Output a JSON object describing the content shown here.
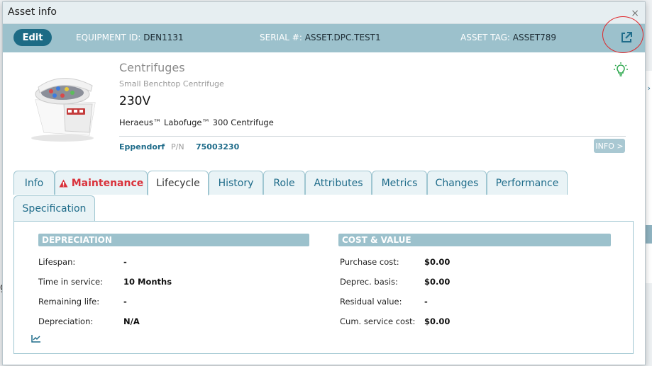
{
  "modal": {
    "title": "Asset info",
    "close": "×"
  },
  "header": {
    "edit_label": "Edit",
    "equipment_id_label": "EQUIPMENT ID:",
    "equipment_id": "DEN1131",
    "serial_label": "SERIAL #:",
    "serial": "ASSET.DPC.TEST1",
    "asset_tag_label": "ASSET TAG:",
    "asset_tag": "ASSET789",
    "external_link_icon": "external-link-icon"
  },
  "asset": {
    "category": "Centrifuges",
    "subcategory": "Small Benchtop Centrifuge",
    "voltage": "230V",
    "model": "Heraeus™ Labofuge™ 300 Centrifuge",
    "manufacturer": "Eppendorf",
    "pn_label": "P/N",
    "pn": "75003230",
    "info_button": "INFO >",
    "image_icon": "centrifuge-image",
    "tip_icon": "lightbulb-icon"
  },
  "tabs": [
    {
      "label": "Info"
    },
    {
      "label": "Maintenance",
      "icon": "warning-icon"
    },
    {
      "label": "Lifecycle"
    },
    {
      "label": "History"
    },
    {
      "label": "Role"
    },
    {
      "label": "Attributes"
    },
    {
      "label": "Metrics"
    },
    {
      "label": "Changes"
    },
    {
      "label": "Performance"
    },
    {
      "label": "Specification"
    }
  ],
  "depreciation": {
    "title": "DEPRECIATION",
    "rows": [
      {
        "label": "Lifespan:",
        "value": "-"
      },
      {
        "label": "Time in service:",
        "value": "10 Months"
      },
      {
        "label": "Remaining life:",
        "value": "-"
      },
      {
        "label": "Depreciation:",
        "value": "N/A"
      }
    ]
  },
  "cost": {
    "title": "COST & VALUE",
    "rows": [
      {
        "label": "Purchase cost:",
        "value": "$0.00"
      },
      {
        "label": "Deprec. basis:",
        "value": "$0.00"
      },
      {
        "label": "Residual value:",
        "value": "-"
      },
      {
        "label": "Cum. service cost:",
        "value": "$0.00"
      }
    ]
  },
  "colors": {
    "header_bg": "#9cc1cc",
    "accent": "#1f6c8a",
    "warning": "#d9323b",
    "highlight_circle": "#e0262a"
  }
}
